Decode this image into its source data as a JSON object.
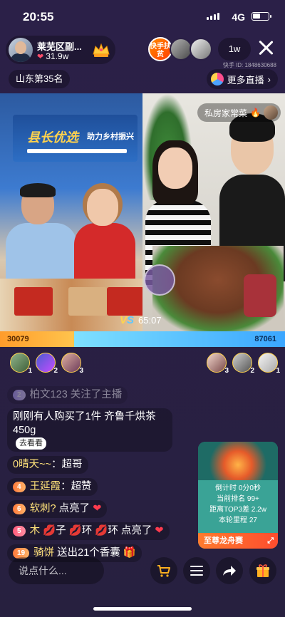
{
  "status_bar": {
    "time": "20:55",
    "network": "4G"
  },
  "host": {
    "name": "莱芜区副...",
    "likes": "31.9w"
  },
  "audience": {
    "fupin_badge": "快手扶贫",
    "count": "1w"
  },
  "top": {
    "rank_label": "山东第35名",
    "more_live_label": "更多直播",
    "uid": "快手 ID: 1848630688"
  },
  "left_video": {
    "banner_title": "县长优选",
    "banner_sub": "助力乡村振兴"
  },
  "right_video": {
    "room_tag": "私房家常菜"
  },
  "pk": {
    "timer": "65:07",
    "score_left": "30079",
    "score_right": "87061"
  },
  "contributors_left": [
    {
      "rank": "1"
    },
    {
      "rank": "2"
    },
    {
      "rank": "3"
    }
  ],
  "contributors_right": [
    {
      "rank": "3"
    },
    {
      "rank": "2"
    },
    {
      "rank": "1"
    }
  ],
  "chat": [
    {
      "level": "2",
      "nick": "柏文123",
      "text": "关注了主播",
      "faded": true
    },
    {
      "text": "刚刚有人购买了1件 齐鲁千烘茶450g",
      "action": "去看看"
    },
    {
      "nick": "0晴天~~",
      "text": "超哥"
    },
    {
      "level": "4",
      "nick": "王延霞",
      "text": "超赞"
    },
    {
      "level": "6",
      "nick": "软刺?",
      "text": "点亮了"
    },
    {
      "level": "5",
      "nick": "木",
      "text": "子",
      "text2": "环",
      "text3": "环 点亮了"
    },
    {
      "level": "19",
      "nick": "骑饼",
      "text": "送出21个香囊"
    }
  ],
  "card": {
    "countdown": "倒计时 0分0秒",
    "rank": "当前排名 99+",
    "gap": "距离TOP3差 2.2w",
    "mileage": "本轮里程 27",
    "button": "至尊龙舟赛"
  },
  "bottom": {
    "input_placeholder": "说点什么..."
  },
  "colors": {
    "accent_orange": "#ff9c2b",
    "accent_blue": "#3aa6ff",
    "bg": "#2a1f45"
  }
}
